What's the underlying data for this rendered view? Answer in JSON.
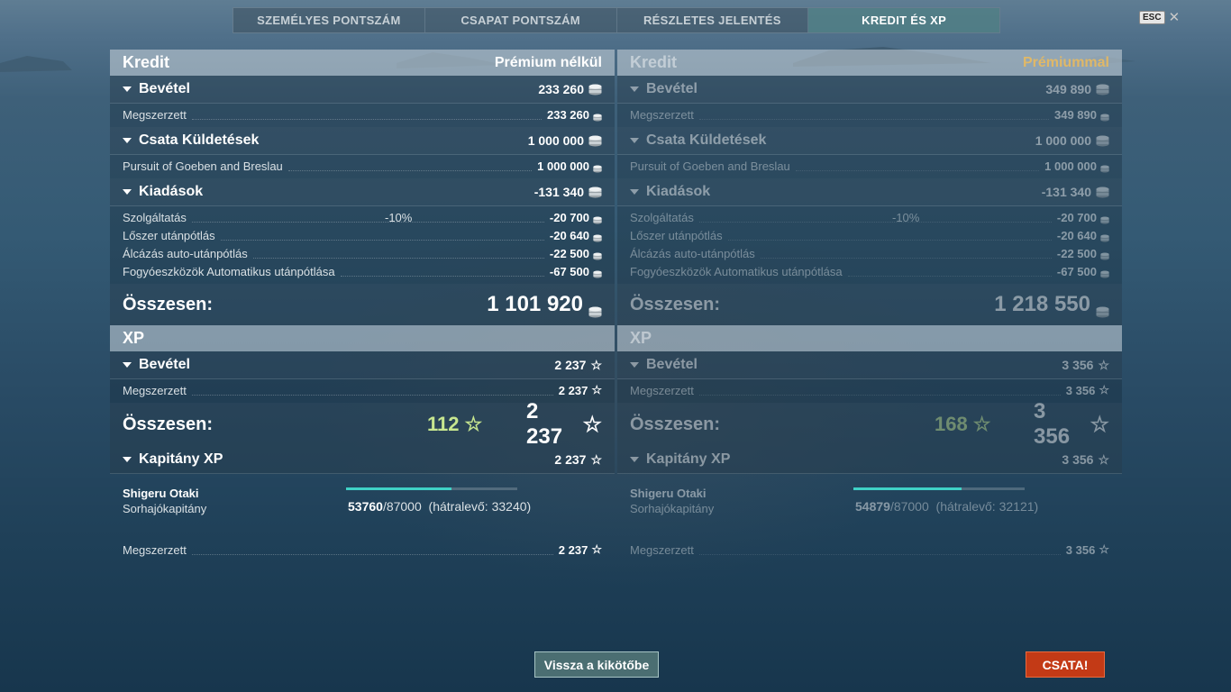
{
  "tabs": [
    {
      "label": "SZEMÉLYES PONTSZÁM",
      "active": false
    },
    {
      "label": "CSAPAT PONTSZÁM",
      "active": false
    },
    {
      "label": "RÉSZLETES JELENTÉS",
      "active": false
    },
    {
      "label": "KREDIT ÉS XP",
      "active": true
    }
  ],
  "esc": {
    "key": "ESC",
    "close_glyph": "✕"
  },
  "left": {
    "credit_header": "Kredit",
    "variant": "Prémium nélkül",
    "income": {
      "label": "Bevétel",
      "value": "233 260"
    },
    "earned": {
      "label": "Megszerzett",
      "value": "233 260"
    },
    "missions": {
      "label": "Csata Küldetések",
      "value": "1 000 000"
    },
    "mission_row": {
      "label": "Pursuit of Goeben and Breslau",
      "value": "1 000 000"
    },
    "expenses": {
      "label": "Kiadások",
      "value": "-131 340"
    },
    "expense_rows": [
      {
        "label": "Szolgáltatás",
        "pct": "-10%",
        "value": "-20 700"
      },
      {
        "label": "Lőszer utánpótlás",
        "pct": "",
        "value": "-20 640"
      },
      {
        "label": "Álcázás auto-utánpótlás",
        "pct": "",
        "value": "-22 500"
      },
      {
        "label": "Fogyóeszközök Automatikus utánpótlása",
        "pct": "",
        "value": "-67 500"
      }
    ],
    "credit_total": {
      "label": "Összesen:",
      "value": "1 101 920"
    },
    "xp_header": "XP",
    "xp_income": {
      "label": "Bevétel",
      "value": "2 237"
    },
    "xp_earned": {
      "label": "Megszerzett",
      "value": "2 237"
    },
    "xp_total": {
      "label": "Összesen:",
      "bonus": "112",
      "value": "2 237"
    },
    "captain": {
      "label": "Kapitány XP",
      "value": "2 237",
      "name": "Shigeru Otaki",
      "rank": "Sorhajókapitány",
      "current": "53760",
      "max": "/87000",
      "remaining": "(hátralevő: 33240)",
      "progress": 0.618
    },
    "captain_earned": {
      "label": "Megszerzett",
      "value": "2 237"
    }
  },
  "right": {
    "credit_header": "Kredit",
    "variant": "Prémiummal",
    "income": {
      "label": "Bevétel",
      "value": "349 890"
    },
    "earned": {
      "label": "Megszerzett",
      "value": "349 890"
    },
    "missions": {
      "label": "Csata Küldetések",
      "value": "1 000 000"
    },
    "mission_row": {
      "label": "Pursuit of Goeben and Breslau",
      "value": "1 000 000"
    },
    "expenses": {
      "label": "Kiadások",
      "value": "-131 340"
    },
    "expense_rows": [
      {
        "label": "Szolgáltatás",
        "pct": "-10%",
        "value": "-20 700"
      },
      {
        "label": "Lőszer utánpótlás",
        "pct": "",
        "value": "-20 640"
      },
      {
        "label": "Álcázás auto-utánpótlás",
        "pct": "",
        "value": "-22 500"
      },
      {
        "label": "Fogyóeszközök Automatikus utánpótlása",
        "pct": "",
        "value": "-67 500"
      }
    ],
    "credit_total": {
      "label": "Összesen:",
      "value": "1 218 550"
    },
    "xp_header": "XP",
    "xp_income": {
      "label": "Bevétel",
      "value": "3 356"
    },
    "xp_earned": {
      "label": "Megszerzett",
      "value": "3 356"
    },
    "xp_total": {
      "label": "Összesen:",
      "bonus": "168",
      "value": "3 356"
    },
    "captain": {
      "label": "Kapitány XP",
      "value": "3 356",
      "name": "Shigeru Otaki",
      "rank": "Sorhajókapitány",
      "current": "54879",
      "max": "/87000",
      "remaining": "(hátralevő: 32121)",
      "progress": 0.631
    },
    "captain_earned": {
      "label": "Megszerzett",
      "value": "3 356"
    }
  },
  "buttons": {
    "back": "Vissza a kikötőbe",
    "battle": "CSATA!"
  },
  "icons": {
    "credit": "credit-coin-icon",
    "xp": "xp-star-icon"
  },
  "colors": {
    "accent_tab": "#5a9696",
    "premium": "#e0b867",
    "bonus_xp": "#c7e68f",
    "battle": "#c33a16",
    "progress": "#3fd1c6"
  }
}
